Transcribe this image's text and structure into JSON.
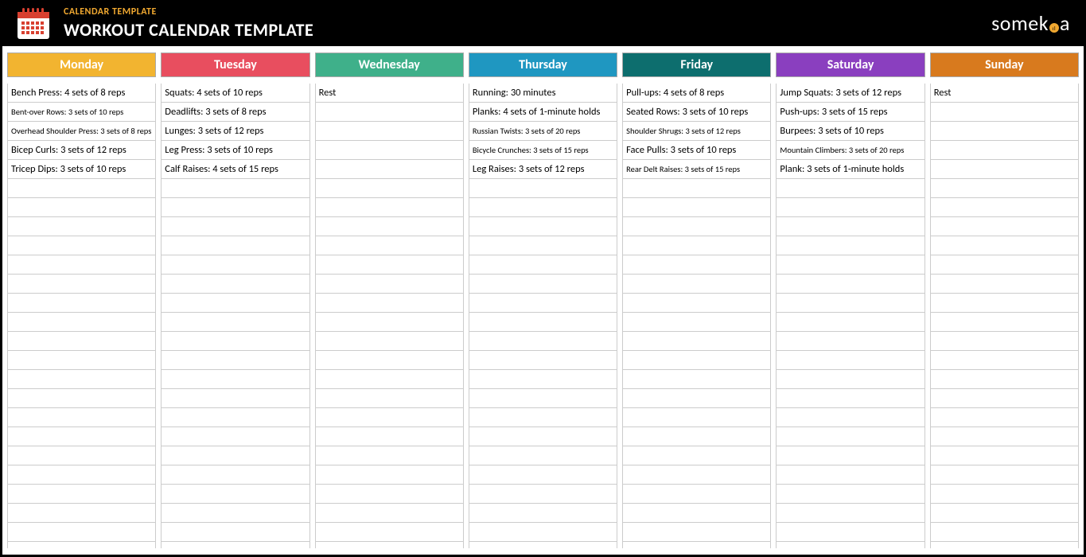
{
  "header": {
    "subtitle": "CALENDAR TEMPLATE",
    "title": "WORKOUT CALENDAR TEMPLATE",
    "brand": "someka"
  },
  "rowsPerDay": 24,
  "days": [
    {
      "name": "Monday",
      "color": "#f2b430",
      "entries": [
        "Bench Press: 4 sets of 8 reps",
        "Bent-over Rows: 3 sets of 10 reps",
        "Overhead Shoulder Press: 3 sets of 8 reps",
        "Bicep Curls: 3 sets of 12 reps",
        "Tricep Dips: 3 sets of 10 reps"
      ]
    },
    {
      "name": "Tuesday",
      "color": "#e84e5f",
      "entries": [
        "Squats: 4 sets of 10 reps",
        "Deadlifts: 3 sets of 8 reps",
        "Lunges: 3 sets of 12 reps",
        "Leg Press: 3 sets of 10 reps",
        "Calf Raises: 4 sets of 15 reps"
      ]
    },
    {
      "name": "Wednesday",
      "color": "#3fb08a",
      "entries": [
        "Rest"
      ]
    },
    {
      "name": "Thursday",
      "color": "#1f97c1",
      "entries": [
        "Running: 30 minutes",
        "Planks: 4 sets of 1-minute holds",
        "Russian Twists: 3 sets of 20 reps",
        "Bicycle Crunches: 3 sets of 15 reps",
        "Leg Raises: 3 sets of 12 reps"
      ]
    },
    {
      "name": "Friday",
      "color": "#0d6e6e",
      "entries": [
        "Pull-ups: 4 sets of 8 reps",
        "Seated Rows: 3 sets of 10 reps",
        "Shoulder Shrugs: 3 sets of 12 reps",
        "Face Pulls: 3 sets of 10 reps",
        "Rear Delt Raises: 3 sets of 15 reps"
      ]
    },
    {
      "name": "Saturday",
      "color": "#8a3fbf",
      "entries": [
        "Jump Squats: 3 sets of 12 reps",
        "Push-ups: 3 sets of 15 reps",
        "Burpees: 3 sets of 10 reps",
        "Mountain Climbers: 3 sets of 20 reps",
        "Plank: 3 sets of 1-minute holds"
      ]
    },
    {
      "name": "Sunday",
      "color": "#d87a1e",
      "entries": [
        "Rest"
      ]
    }
  ]
}
